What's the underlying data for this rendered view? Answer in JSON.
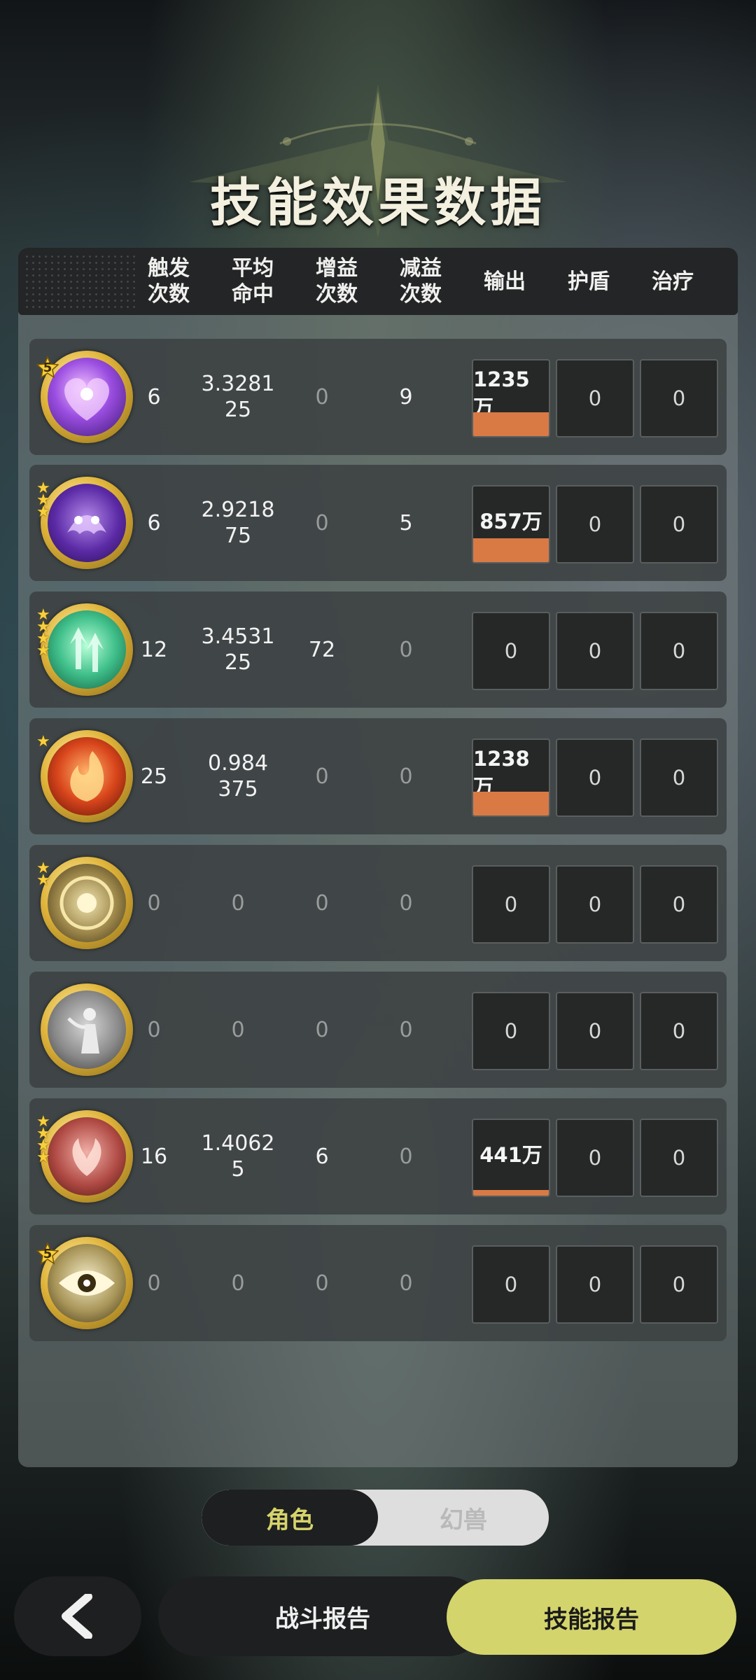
{
  "title": "技能效果数据",
  "columns": [
    "触发\n次数",
    "平均\n命中",
    "增益\n次数",
    "减益\n次数",
    "输出",
    "护盾",
    "治疗"
  ],
  "rows": [
    {
      "icon": "purple-heart-icon",
      "stars": "badge",
      "badge": "5",
      "trigger": "6",
      "avg_hit": "3.3281\n25",
      "buff": "0",
      "debuff": "9",
      "output": "1235万",
      "output_ratio": 0.998,
      "shield": "0",
      "heal": "0"
    },
    {
      "icon": "ghost-face-icon",
      "stars": 3,
      "trigger": "6",
      "avg_hit": "2.9218\n75",
      "buff": "0",
      "debuff": "5",
      "output": "857万",
      "output_ratio": 0.69,
      "shield": "0",
      "heal": "0"
    },
    {
      "icon": "green-arrows-icon",
      "stars": 4,
      "trigger": "12",
      "avg_hit": "3.4531\n25",
      "buff": "72",
      "debuff": "0",
      "output": "0",
      "output_ratio": 0,
      "shield": "0",
      "heal": "0"
    },
    {
      "icon": "fire-swirl-icon",
      "stars": 1,
      "trigger": "25",
      "avg_hit": "0.984\n375",
      "buff": "0",
      "debuff": "0",
      "output": "1238万",
      "output_ratio": 1.0,
      "shield": "0",
      "heal": "0"
    },
    {
      "icon": "golden-vortex-icon",
      "stars": 2,
      "trigger": "0",
      "avg_hit": "0",
      "buff": "0",
      "debuff": "0",
      "output": "0",
      "output_ratio": 0,
      "shield": "0",
      "heal": "0"
    },
    {
      "icon": "silver-figure-icon",
      "stars": 0,
      "trigger": "0",
      "avg_hit": "0",
      "buff": "0",
      "debuff": "0",
      "output": "0",
      "output_ratio": 0,
      "shield": "0",
      "heal": "0"
    },
    {
      "icon": "red-wings-icon",
      "stars": 4,
      "trigger": "16",
      "avg_hit": "1.4062\n5",
      "buff": "6",
      "debuff": "0",
      "output": "441万",
      "output_ratio": 0.36,
      "shield": "0",
      "heal": "0"
    },
    {
      "icon": "golden-eye-icon",
      "stars": "badge",
      "badge": "5",
      "trigger": "0",
      "avg_hit": "0",
      "buff": "0",
      "debuff": "0",
      "output": "0",
      "output_ratio": 0,
      "shield": "0",
      "heal": "0"
    }
  ],
  "toggle": {
    "active": "角色",
    "inactive": "幻兽"
  },
  "buttons": {
    "battle_report": "战斗报告",
    "skill_report": "技能报告"
  },
  "colors": {
    "accent": "#d3d46c",
    "output_bar": "#d97a45",
    "panel": "#3c4142"
  }
}
